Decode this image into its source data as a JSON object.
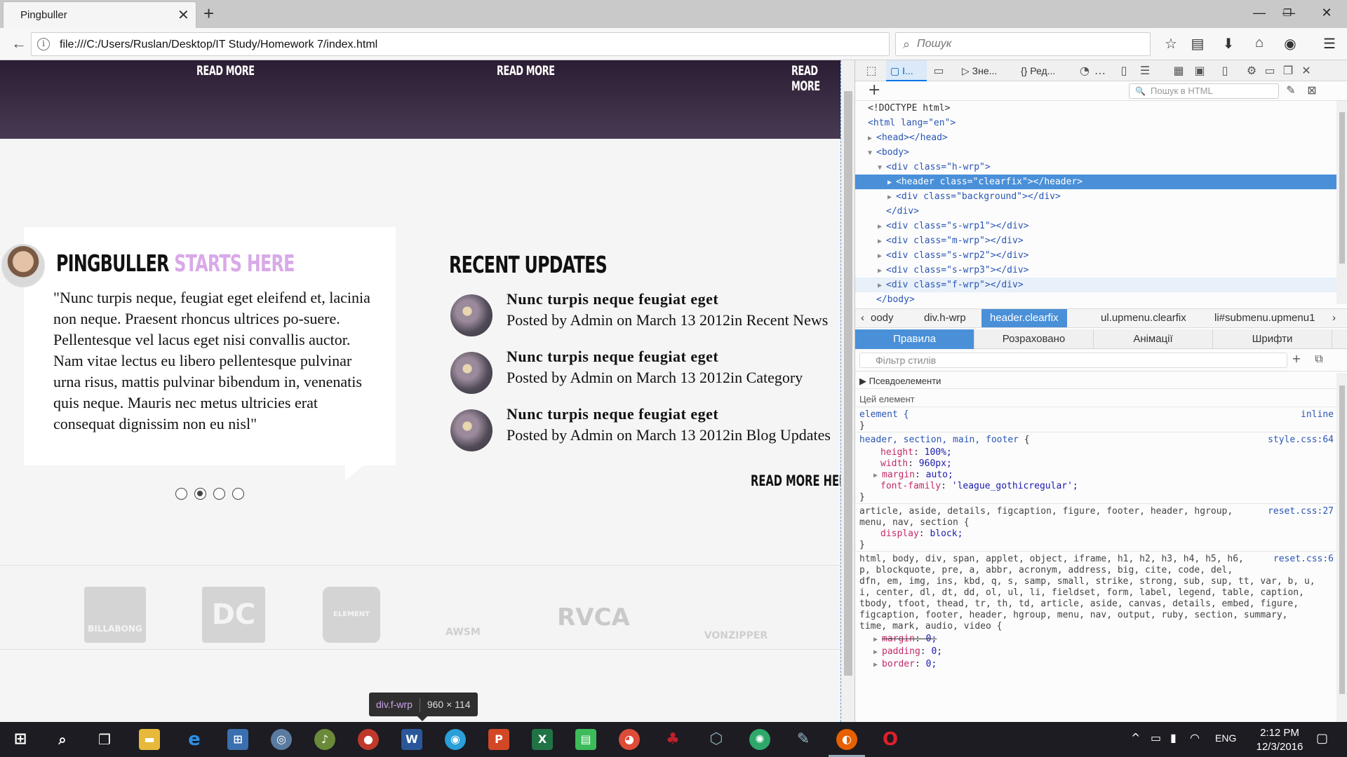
{
  "browser": {
    "tab_title": "Pingbuller",
    "url": "file:///C:/Users/Ruslan/Desktop/IT Study/Homework 7/index.html",
    "search_placeholder": "Пошук"
  },
  "page": {
    "read_more": [
      "READ MORE",
      "READ MORE",
      "READ MORE"
    ],
    "pb_title_a": "PINGBULLER",
    "pb_title_b": "STARTS HERE",
    "quote": "\"Nunc turpis neque, feugiat eget eleifend et, lacinia non neque. Praesent rhoncus ultrices po-suere. Pellentesque vel lacus eget nisi convallis auctor. Nam vitae lectus eu libero pellentesque pulvinar urna risus, mattis pulvinar bibendum in, venenatis quis neque. Mauris nec metus ultricies erat consequat dignissim non eu nisl\"",
    "slider_active_index": 1,
    "recent_title": "RECENT UPDATES",
    "updates": [
      {
        "title": "Nunc turpis neque feugiat eget",
        "sub": "Posted by Admin on March 13 2012in Recent News"
      },
      {
        "title": "Nunc turpis neque feugiat eget",
        "sub": "Posted by Admin on March 13 2012in Category"
      },
      {
        "title": "Nunc turpis neque feugiat eget",
        "sub": "Posted by Admin on March 13 2012in Blog Updates"
      }
    ],
    "read_more_here": "READ MORE HERE",
    "brands": [
      "BILLABONG",
      "DC",
      "ELEMENT",
      "AWSM",
      "RVCA",
      "VONZIPPER"
    ],
    "tooltip_tag": "div.f-wrp",
    "tooltip_size": "960 × 114"
  },
  "devtools": {
    "tabs": [
      "I...",
      "Зне...",
      "Ред..."
    ],
    "html_search_placeholder": "Пошук в HTML",
    "dom": [
      "<!DOCTYPE html>",
      "<html lang=\"en\">",
      "<head></head>",
      "<body>",
      "<div class=\"h-wrp\">",
      "<header class=\"clearfix\"></header>",
      "<div class=\"background\"></div>",
      "</div>",
      "<div class=\"s-wrp1\"></div>",
      "<div class=\"m-wrp\"></div>",
      "<div class=\"s-wrp2\"></div>",
      "<div class=\"s-wrp3\"></div>",
      "<div class=\"f-wrp\"></div>",
      "</body>"
    ],
    "breadcrumbs": [
      "oody",
      "div.h-wrp",
      "header.clearfix",
      "ul.upmenu.clearfix",
      "li#submenu.upmenu1"
    ],
    "side_tabs": [
      "Правила",
      "Розраховано",
      "Анімації",
      "Шрифти"
    ],
    "filter_placeholder": "Фільтр стилів",
    "pseudo": "Псевдоелементи",
    "this_element": "Цей елемент",
    "rules": {
      "element_sel": "element {",
      "inline": "inline",
      "r1_sel": "header, section, main, footer",
      "r1_src": "style.css:64",
      "r1_props": [
        [
          "height",
          "100%;"
        ],
        [
          "width",
          "960px;"
        ],
        [
          "margin",
          "auto;"
        ],
        [
          "font-family",
          "'league_gothicregular';"
        ]
      ],
      "r2_sel": "article, aside, details, figcaption, figure, footer, header, hgroup,",
      "r2_sel2": "menu, nav, section",
      "r2_src": "reset.css:27",
      "r2_props": [
        [
          "display",
          "block;"
        ]
      ],
      "r3_lines": [
        "html, body, div, span, applet, object, iframe, h1, h2, h3, h4, h5, h6,",
        "p, blockquote, pre, a, abbr, acronym, address, big, cite, code, del,",
        "dfn, em, img, ins, kbd, q, s, samp, small, strike, strong, sub, sup, tt, var, b, u,",
        "i, center, dl, dt, dd, ol, ul, li, fieldset, form, label, legend, table, caption,",
        "tbody, tfoot, thead, tr, th, td, article, aside, canvas, details, embed, figure,",
        "figcaption, footer, header, hgroup, menu, nav, output, ruby, section, summary,",
        "time, mark, audio, video"
      ],
      "r3_src": "reset.css:6",
      "r3_props": [
        [
          "margin",
          "0;"
        ],
        [
          "padding",
          "0;"
        ],
        [
          "border",
          "0;"
        ]
      ]
    }
  },
  "taskbar": {
    "lang": "ENG",
    "time": "2:12 PM",
    "date": "12/3/2016"
  }
}
